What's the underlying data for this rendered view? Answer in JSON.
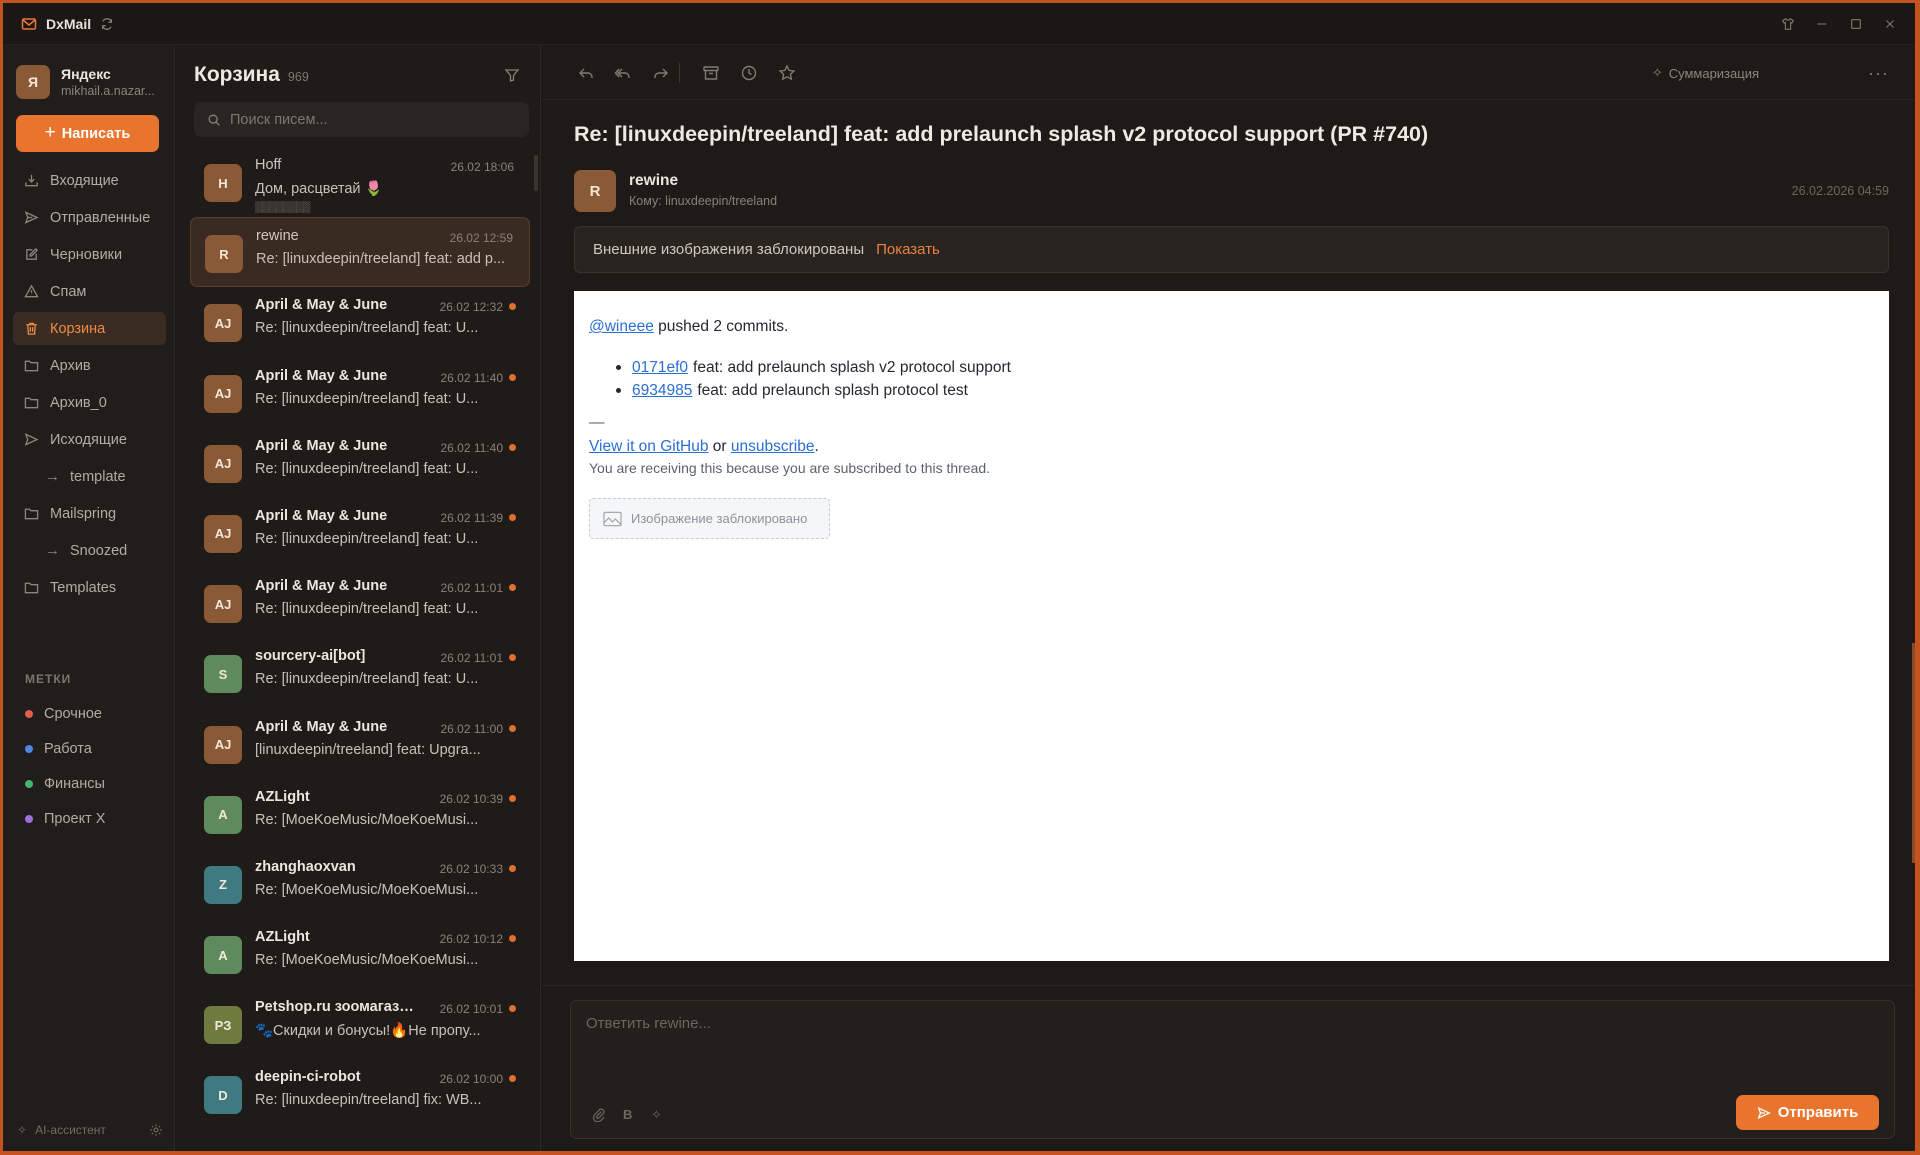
{
  "app": {
    "title": "DxMail"
  },
  "account": {
    "initial": "Я",
    "name": "Яндекс",
    "email": "mikhail.a.nazar..."
  },
  "compose": {
    "label": "Написать"
  },
  "nav": [
    {
      "label": "Входящие",
      "icon": "inbox-icon"
    },
    {
      "label": "Отправленные",
      "icon": "send-icon"
    },
    {
      "label": "Черновики",
      "icon": "edit-icon"
    },
    {
      "label": "Спам",
      "icon": "warning-icon"
    },
    {
      "label": "Корзина",
      "icon": "trash-icon",
      "active": true
    },
    {
      "label": "Архив",
      "icon": "folder-icon"
    },
    {
      "label": "Архив_0",
      "icon": "folder-icon"
    },
    {
      "label": "Исходящие",
      "icon": "outbox-icon"
    },
    {
      "label": "template",
      "sub": true
    },
    {
      "label": "Mailspring",
      "icon": "folder-icon"
    },
    {
      "label": "Snoozed",
      "sub": true
    },
    {
      "label": "Templates",
      "icon": "folder-icon"
    }
  ],
  "labels": {
    "title": "МЕТКИ",
    "items": [
      {
        "label": "Срочное",
        "color": "#e35d4f"
      },
      {
        "label": "Работа",
        "color": "#4f86e3"
      },
      {
        "label": "Финансы",
        "color": "#44b36b"
      },
      {
        "label": "Проект X",
        "color": "#9d6fe0"
      }
    ]
  },
  "assistant": {
    "label": "AI-ассистент"
  },
  "list": {
    "title": "Корзина",
    "count": "969",
    "search_placeholder": "Поиск писем...",
    "messages": [
      {
        "initials": "H",
        "color": "#8a5a36",
        "from": "Hoff",
        "date": "26.02 18:06",
        "subject": "Дом, расцветай 🌷",
        "snippet": "▒▒▒▒▒▒▒▒",
        "read": true
      },
      {
        "initials": "R",
        "color": "#8a5a36",
        "from": "rewine",
        "date": "26.02 12:59",
        "subject": "Re: [linuxdeepin/treeland] feat: add p...",
        "read": true,
        "selected": true
      },
      {
        "initials": "AJ",
        "color": "#8a5a36",
        "from": "April & May & June",
        "date": "26.02 12:32",
        "subject": "Re: [linuxdeepin/treeland] feat: U...",
        "unread": true
      },
      {
        "initials": "AJ",
        "color": "#8a5a36",
        "from": "April & May & June",
        "date": "26.02 11:40",
        "subject": "Re: [linuxdeepin/treeland] feat: U...",
        "unread": true
      },
      {
        "initials": "AJ",
        "color": "#8a5a36",
        "from": "April & May & June",
        "date": "26.02 11:40",
        "subject": "Re: [linuxdeepin/treeland] feat: U...",
        "unread": true
      },
      {
        "initials": "AJ",
        "color": "#8a5a36",
        "from": "April & May & June",
        "date": "26.02 11:39",
        "subject": "Re: [linuxdeepin/treeland] feat: U...",
        "unread": true
      },
      {
        "initials": "AJ",
        "color": "#8a5a36",
        "from": "April & May & June",
        "date": "26.02 11:01",
        "subject": "Re: [linuxdeepin/treeland] feat: U...",
        "unread": true
      },
      {
        "initials": "S",
        "color": "#5f8a5e",
        "from": "sourcery-ai[bot]",
        "date": "26.02 11:01",
        "subject": "Re: [linuxdeepin/treeland] feat: U...",
        "unread": true
      },
      {
        "initials": "AJ",
        "color": "#8a5a36",
        "from": "April & May & June",
        "date": "26.02 11:00",
        "subject": "[linuxdeepin/treeland] feat: Upgra...",
        "unread": true
      },
      {
        "initials": "A",
        "color": "#5f8a5e",
        "from": "AZLight",
        "date": "26.02 10:39",
        "subject": "Re: [MoeKoeMusic/MoeKoeMusi...",
        "unread": true
      },
      {
        "initials": "Z",
        "color": "#3f7a80",
        "from": "zhanghaoxvan",
        "date": "26.02 10:33",
        "subject": "Re: [MoeKoeMusic/MoeKoeMusi...",
        "unread": true
      },
      {
        "initials": "A",
        "color": "#5f8a5e",
        "from": "AZLight",
        "date": "26.02 10:12",
        "subject": "Re: [MoeKoeMusic/MoeKoeMusi...",
        "unread": true
      },
      {
        "initials": "PЗ",
        "color": "#6f7a3f",
        "from": "Petshop.ru зоомагазин",
        "date": "26.02 10:01",
        "subject": "🐾Скидки и бонусы!🔥Не пропу...",
        "unread": true
      },
      {
        "initials": "D",
        "color": "#3f7a80",
        "from": "deepin-ci-robot",
        "date": "26.02 10:00",
        "subject": "Re: [linuxdeepin/treeland] fix: WB...",
        "unread": true
      }
    ]
  },
  "reader": {
    "summarize_label": "Суммаризация",
    "subject": "Re: [linuxdeepin/treeland] feat: add prelaunch splash v2 protocol support (PR #740)",
    "sender": {
      "initial": "R",
      "name": "rewine",
      "to": "Кому: linuxdeepin/treeland"
    },
    "date": "26.02.2026 04:59",
    "blocked": {
      "text": "Внешние изображения заблокированы",
      "show": "Показать"
    },
    "body": {
      "user": "@wineee",
      "pushed": " pushed 2 commits.",
      "commits": [
        {
          "sha": "0171ef0",
          "message": "feat: add prelaunch splash v2 protocol support"
        },
        {
          "sha": "6934985",
          "message": "feat: add prelaunch splash protocol test"
        }
      ],
      "dash": "—",
      "view_link": "View it on GitHub",
      "or": " or ",
      "unsubscribe": "unsubscribe",
      "period": ".",
      "reason": "You are receiving this because you are subscribed to this thread.",
      "image_blocked": "Изображение заблокировано"
    },
    "reply": {
      "placeholder": "Ответить rewine...",
      "send": "Отправить"
    }
  }
}
